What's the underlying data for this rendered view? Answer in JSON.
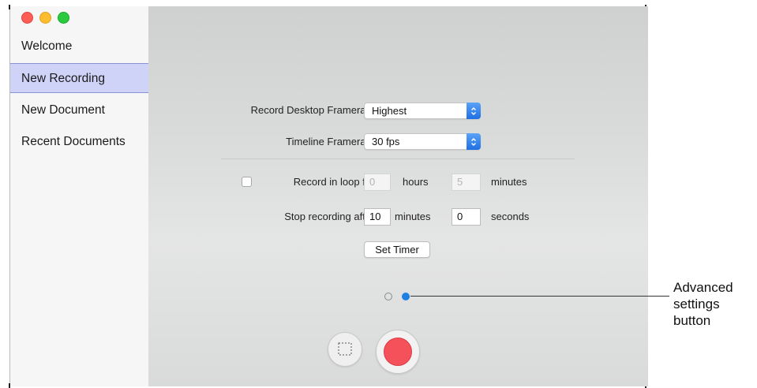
{
  "sidebar": {
    "items": [
      {
        "label": "Welcome"
      },
      {
        "label": "New Recording",
        "selected": true
      },
      {
        "label": "New Document"
      },
      {
        "label": "Recent Documents"
      }
    ]
  },
  "settings": {
    "desktop_framerate": {
      "label": "Record Desktop Framerate:",
      "value": "Highest"
    },
    "timeline_framerate": {
      "label": "Timeline Framerate:",
      "value": "30 fps"
    },
    "loop": {
      "label": "Record in loop for:",
      "checked": false,
      "hours_value": "0",
      "hours_unit": "hours",
      "minutes_value": "5",
      "minutes_unit": "minutes"
    },
    "stop_after": {
      "label": "Stop recording after:",
      "minutes_value": "10",
      "minutes_unit": "minutes",
      "seconds_value": "0",
      "seconds_unit": "seconds"
    },
    "set_timer_label": "Set Timer"
  },
  "pager": {
    "page_count": 2,
    "active_page": 2
  },
  "callout": {
    "line1": "Advanced",
    "line2": "settings",
    "line3": "button"
  },
  "colors": {
    "accent_blue": "#1f6fe3",
    "selected_sidebar": "#cfd3f8",
    "record_red": "#f4515a",
    "close": "#fd5d55",
    "minimize": "#fdbd2e",
    "zoom": "#29c940"
  }
}
